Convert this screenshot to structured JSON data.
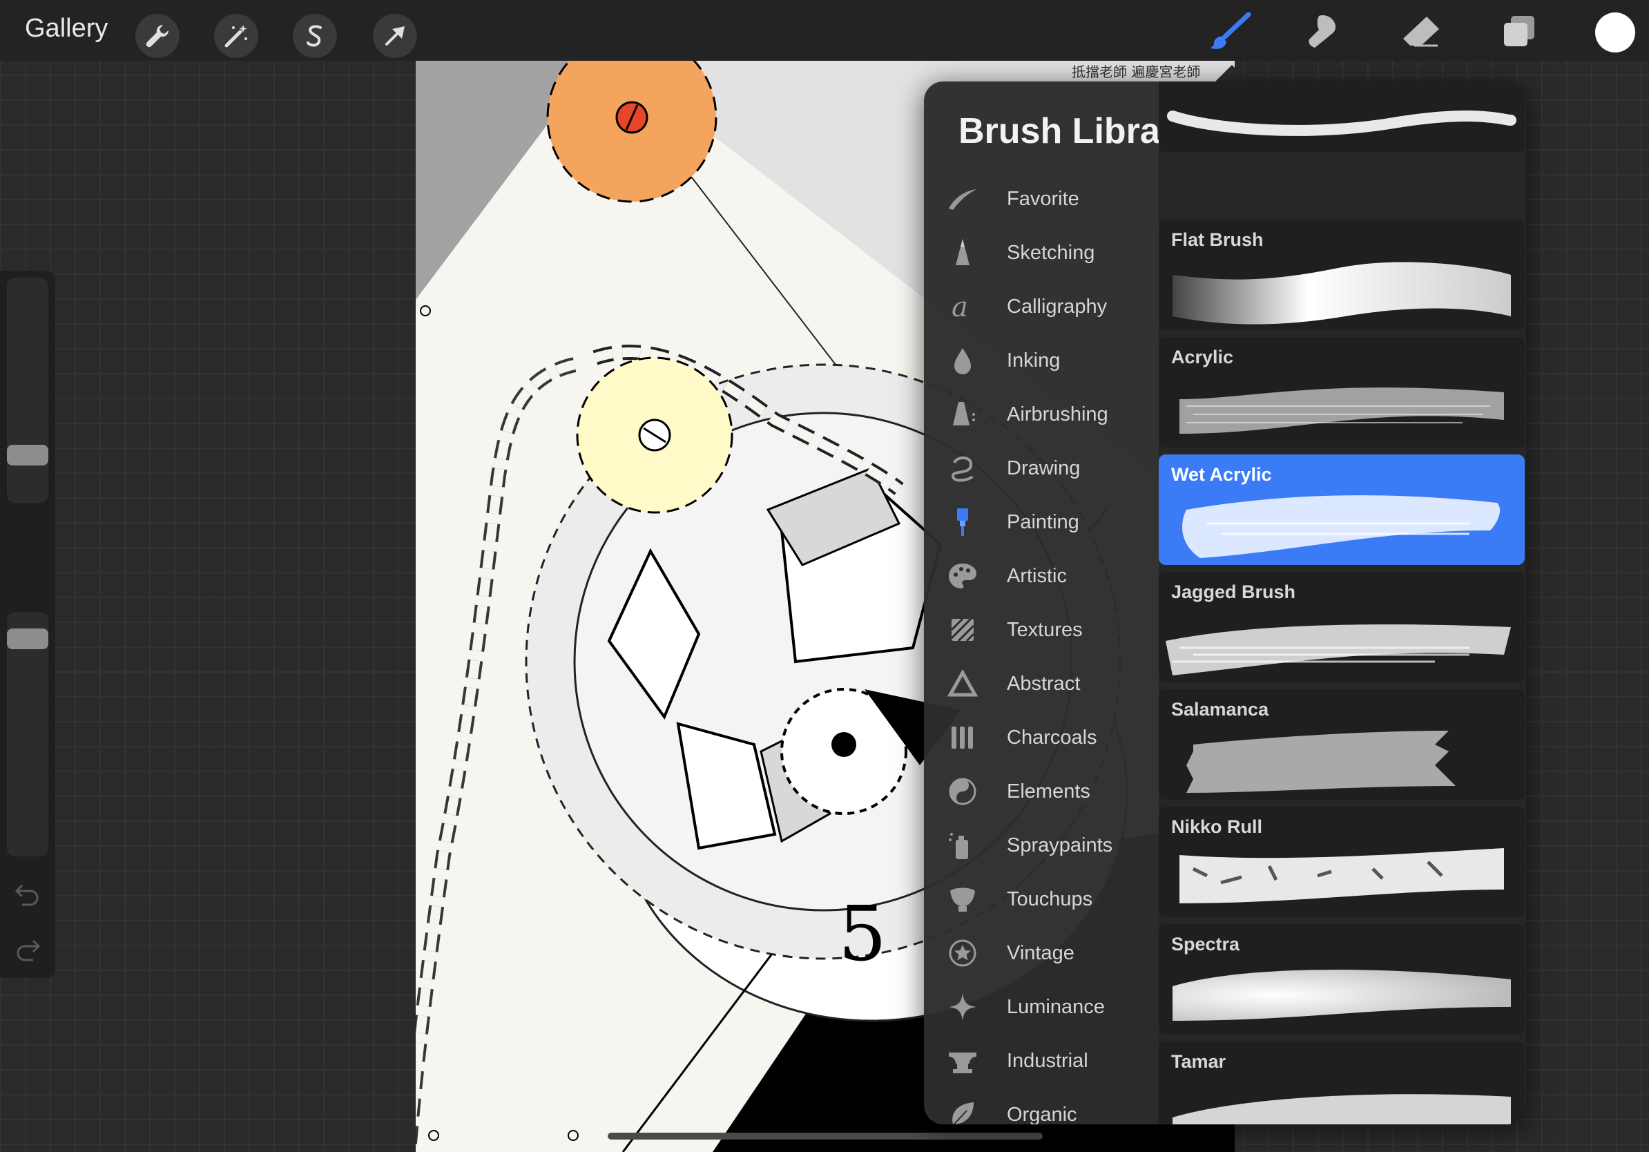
{
  "topbar": {
    "gallery_label": "Gallery",
    "tools_left": [
      "wrench-icon",
      "magic-wand-icon",
      "selection-icon",
      "transform-arrow-icon"
    ],
    "tools_right": [
      "brush-icon",
      "smudge-icon",
      "eraser-icon",
      "layers-icon"
    ],
    "active_tool": "brush-icon",
    "active_color": "#ffffff",
    "accent": "#3b7cf6"
  },
  "canvas": {
    "watermark": "抵擋老師 遍慶宮老師",
    "number_label": "5"
  },
  "library": {
    "title": "Brush Library",
    "categories": [
      {
        "label": "Favorite",
        "icon": "feather-stroke-icon"
      },
      {
        "label": "Sketching",
        "icon": "pencil-tip-icon"
      },
      {
        "label": "Calligraphy",
        "icon": "calligraphy-a-icon"
      },
      {
        "label": "Inking",
        "icon": "ink-drop-icon"
      },
      {
        "label": "Airbrushing",
        "icon": "airbrush-icon"
      },
      {
        "label": "Drawing",
        "icon": "drawing-curve-icon"
      },
      {
        "label": "Painting",
        "icon": "paintbrush-icon"
      },
      {
        "label": "Artistic",
        "icon": "palette-icon"
      },
      {
        "label": "Textures",
        "icon": "texture-stripes-icon"
      },
      {
        "label": "Abstract",
        "icon": "triangle-icon"
      },
      {
        "label": "Charcoals",
        "icon": "charcoal-sticks-icon"
      },
      {
        "label": "Elements",
        "icon": "yin-yang-icon"
      },
      {
        "label": "Spraypaints",
        "icon": "spray-can-icon"
      },
      {
        "label": "Touchups",
        "icon": "touchup-icon"
      },
      {
        "label": "Vintage",
        "icon": "star-circle-icon"
      },
      {
        "label": "Luminance",
        "icon": "sparkle-icon"
      },
      {
        "label": "Industrial",
        "icon": "anvil-icon"
      },
      {
        "label": "Organic",
        "icon": "leaf-icon"
      }
    ],
    "brushes": [
      {
        "name": "",
        "selected": false
      },
      {
        "name": "Flat Brush",
        "selected": false
      },
      {
        "name": "Acrylic",
        "selected": false
      },
      {
        "name": "Wet Acrylic",
        "selected": true
      },
      {
        "name": "Jagged Brush",
        "selected": false
      },
      {
        "name": "Salamanca",
        "selected": false
      },
      {
        "name": "Nikko Rull",
        "selected": false
      },
      {
        "name": "Spectra",
        "selected": false
      },
      {
        "name": "Tamar",
        "selected": false
      }
    ]
  }
}
